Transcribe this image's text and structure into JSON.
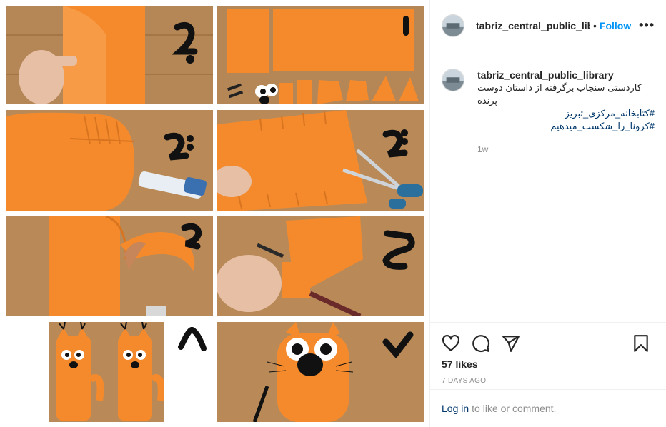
{
  "post": {
    "username": "tabriz_central_public_library",
    "follow_label": "Follow",
    "more_label": "•••",
    "header_dot": "•",
    "caption_line1": "کاردستی سنجاب برگرفته از داستان دوست پرنده",
    "hashtags": [
      "#کتابخانه_مرکزی_تبریز",
      "#کرونا_را_شکست_میدهیم"
    ],
    "comment_age": "1w",
    "likes_text": "57 likes",
    "posted_ago": "7 DAYS AGO",
    "login_link": "Log in",
    "login_rest": "to like or comment."
  },
  "icons": {
    "like": "heart-icon",
    "comment": "comment-bubble-icon",
    "share": "paper-plane-icon",
    "save": "bookmark-icon"
  },
  "colors": {
    "accent": "#0095f6",
    "link": "#00376b",
    "muted": "#8e8e8e",
    "paper": "#f58a2c",
    "wood": "#b98a58"
  }
}
